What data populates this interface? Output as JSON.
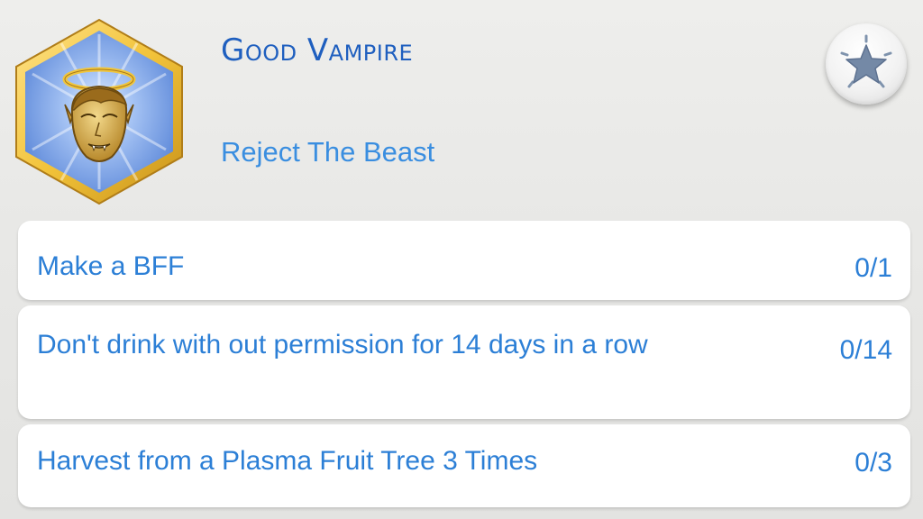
{
  "aspiration": {
    "title": "Good Vampire",
    "subtitle": "Reject The Beast",
    "badge_icon": "angel-vampire-halo-icon",
    "favorite_icon": "star-icon"
  },
  "tasks": [
    {
      "label": "Make a BFF",
      "progress": "0/1"
    },
    {
      "label": "Don't drink with out permission for 14 days in a row",
      "progress": "0/14"
    },
    {
      "label": "Harvest from a Plasma Fruit Tree 3 Times",
      "progress": "0/3"
    }
  ],
  "colors": {
    "title": "#1f5fbf",
    "subtitle": "#3a8ee0",
    "task_text": "#2c7fd6",
    "badge_frame": "#f2c33a",
    "badge_fill": "#6e9be4",
    "background": "#e8e8e6"
  }
}
